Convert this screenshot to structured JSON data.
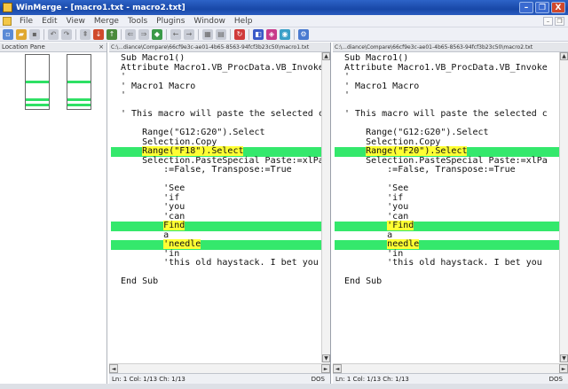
{
  "window": {
    "title": "WinMerge - [macro1.txt - macro2.txt]",
    "controls": {
      "minimize": "–",
      "maximize": "❐",
      "close": "X"
    }
  },
  "menu": [
    "File",
    "Edit",
    "View",
    "Merge",
    "Tools",
    "Plugins",
    "Window",
    "Help"
  ],
  "location_pane": {
    "title": "Location Pane",
    "close": "×"
  },
  "left_panel": {
    "path": "C:\\...diance\\Compare\\66cf9e3c-ae01-4b65-8563-94fcf3b23c50\\macro1.txt",
    "lines": [
      {
        "pre": "Sub Macro1()",
        "hl": "",
        "post": "",
        "diff": false
      },
      {
        "pre": "Attribute Macro1.VB_ProcData.VB_Invoke",
        "hl": "",
        "post": "",
        "diff": false
      },
      {
        "pre": "'",
        "hl": "",
        "post": "",
        "diff": false
      },
      {
        "pre": "' Macro1 Macro",
        "hl": "",
        "post": "",
        "diff": false
      },
      {
        "pre": "'",
        "hl": "",
        "post": "",
        "diff": false
      },
      {
        "pre": "",
        "hl": "",
        "post": "",
        "diff": false
      },
      {
        "pre": "' This macro will paste the selected c",
        "hl": "",
        "post": "",
        "diff": false
      },
      {
        "pre": "",
        "hl": "",
        "post": "",
        "diff": false
      },
      {
        "pre": "    Range(\"G12:G20\").Select",
        "hl": "",
        "post": "",
        "diff": false
      },
      {
        "pre": "    Selection.Copy",
        "hl": "",
        "post": "",
        "diff": false
      },
      {
        "pre": "    ",
        "hl": "Range(\"F18\").Select",
        "post": "",
        "diff": true
      },
      {
        "pre": "    Selection.PasteSpecial Paste:=xlPa",
        "hl": "",
        "post": "",
        "diff": false
      },
      {
        "pre": "        :=False, Transpose:=True",
        "hl": "",
        "post": "",
        "diff": false
      },
      {
        "pre": "",
        "hl": "",
        "post": "",
        "diff": false
      },
      {
        "pre": "        'See",
        "hl": "",
        "post": "",
        "diff": false
      },
      {
        "pre": "        'if",
        "hl": "",
        "post": "",
        "diff": false
      },
      {
        "pre": "        'you",
        "hl": "",
        "post": "",
        "diff": false
      },
      {
        "pre": "        'can",
        "hl": "",
        "post": "",
        "diff": false
      },
      {
        "pre": "        ",
        "hl": "Find",
        "post": "",
        "diff": true
      },
      {
        "pre": "        a",
        "hl": "",
        "post": "",
        "diff": false
      },
      {
        "pre": "        ",
        "hl": "'needle",
        "post": "",
        "diff": true
      },
      {
        "pre": "        'in",
        "hl": "",
        "post": "",
        "diff": false
      },
      {
        "pre": "        'this old haystack. I bet you",
        "hl": "",
        "post": "",
        "diff": false
      },
      {
        "pre": "",
        "hl": "",
        "post": "",
        "diff": false
      },
      {
        "pre": "End Sub",
        "hl": "",
        "post": "",
        "diff": false
      }
    ],
    "status": "Ln: 1  Col: 1/13  Ch: 1/13",
    "eol": "DOS"
  },
  "right_panel": {
    "path": "C:\\...diance\\Compare\\66cf9e3c-ae01-4b65-8563-94fcf3b23c50\\macro2.txt",
    "lines": [
      {
        "pre": "Sub Macro1()",
        "hl": "",
        "post": "",
        "diff": false
      },
      {
        "pre": "Attribute Macro1.VB_ProcData.VB_Invoke",
        "hl": "",
        "post": "",
        "diff": false
      },
      {
        "pre": "'",
        "hl": "",
        "post": "",
        "diff": false
      },
      {
        "pre": "' Macro1 Macro",
        "hl": "",
        "post": "",
        "diff": false
      },
      {
        "pre": "'",
        "hl": "",
        "post": "",
        "diff": false
      },
      {
        "pre": "",
        "hl": "",
        "post": "",
        "diff": false
      },
      {
        "pre": "' This macro will paste the selected c",
        "hl": "",
        "post": "",
        "diff": false
      },
      {
        "pre": "",
        "hl": "",
        "post": "",
        "diff": false
      },
      {
        "pre": "    Range(\"G12:G20\").Select",
        "hl": "",
        "post": "",
        "diff": false
      },
      {
        "pre": "    Selection.Copy",
        "hl": "",
        "post": "",
        "diff": false
      },
      {
        "pre": "    ",
        "hl": "Range(\"F20\").Select",
        "post": "",
        "diff": true
      },
      {
        "pre": "    Selection.PasteSpecial Paste:=xlPa",
        "hl": "",
        "post": "",
        "diff": false
      },
      {
        "pre": "        :=False, Transpose:=True",
        "hl": "",
        "post": "",
        "diff": false
      },
      {
        "pre": "",
        "hl": "",
        "post": "",
        "diff": false
      },
      {
        "pre": "        'See",
        "hl": "",
        "post": "",
        "diff": false
      },
      {
        "pre": "        'if",
        "hl": "",
        "post": "",
        "diff": false
      },
      {
        "pre": "        'you",
        "hl": "",
        "post": "",
        "diff": false
      },
      {
        "pre": "        'can",
        "hl": "",
        "post": "",
        "diff": false
      },
      {
        "pre": "        ",
        "hl": "'Find",
        "post": "",
        "diff": true
      },
      {
        "pre": "        a",
        "hl": "",
        "post": "",
        "diff": false
      },
      {
        "pre": "        ",
        "hl": "needle",
        "post": "",
        "diff": true
      },
      {
        "pre": "        'in",
        "hl": "",
        "post": "",
        "diff": false
      },
      {
        "pre": "        'this old haystack. I bet you",
        "hl": "",
        "post": "",
        "diff": false
      },
      {
        "pre": "",
        "hl": "",
        "post": "",
        "diff": false
      },
      {
        "pre": "End Sub",
        "hl": "",
        "post": "",
        "diff": false
      }
    ],
    "status": "Ln: 1  Col: 1/13  Ch: 1/13",
    "eol": "DOS"
  },
  "colors": {
    "diff_line": "#34e86c",
    "diff_highlight": "#ffff33",
    "titlebar": "#1848a8"
  },
  "icons": [
    "open-folder-icon",
    "save-icon",
    "undo-icon",
    "redo-icon",
    "next-diff-icon",
    "prev-diff-icon",
    "copy-left-icon",
    "copy-right-icon",
    "options-icon"
  ]
}
